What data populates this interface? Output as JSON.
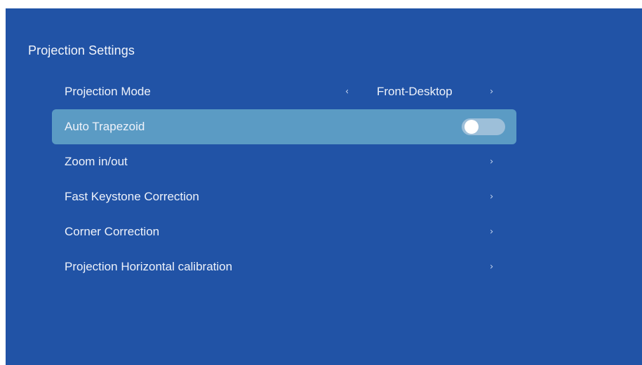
{
  "header": {
    "title": "Projection Settings"
  },
  "menu": {
    "items": [
      {
        "label": "Projection Mode",
        "value": "Front-Desktop",
        "left_icon": "chevron-left-icon",
        "right_icon": "chevron-right-icon"
      },
      {
        "label": "Auto Trapezoid",
        "toggle_on": false,
        "selected": true
      },
      {
        "label": "Zoom in/out",
        "right_icon": "chevron-right-icon"
      },
      {
        "label": "Fast Keystone Correction",
        "right_icon": "chevron-right-icon"
      },
      {
        "label": "Corner Correction",
        "right_icon": "chevron-right-icon"
      },
      {
        "label": "Projection Horizontal calibration",
        "right_icon": "chevron-right-icon"
      }
    ]
  },
  "glyphs": {
    "chevron_left": "‹",
    "chevron_right": "›"
  },
  "colors": {
    "background": "#2153a6",
    "selected_row": "#5b9bc4",
    "toggle_track": "#9dbfd9",
    "toggle_knob": "#ffffff",
    "text": "#eef2fa"
  }
}
